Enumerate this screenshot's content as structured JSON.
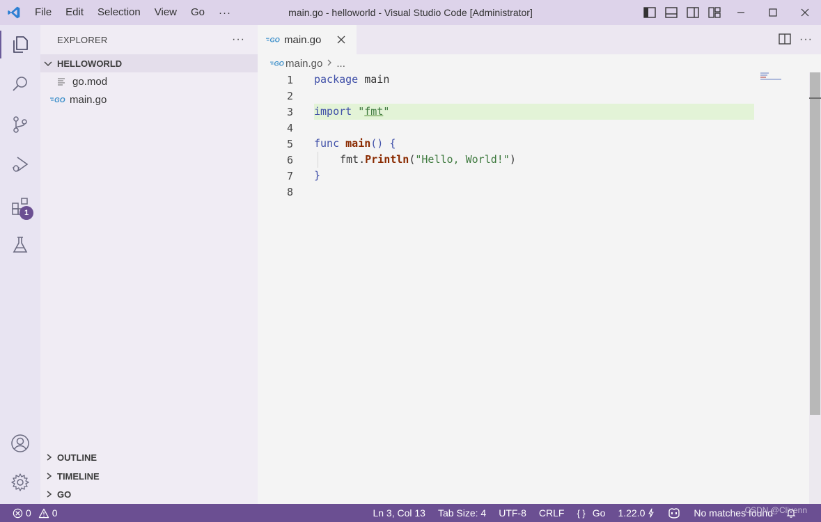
{
  "window": {
    "title": "main.go - helloworld - Visual Studio Code [Administrator]",
    "menu": [
      "File",
      "Edit",
      "Selection",
      "View",
      "Go"
    ],
    "menu_more": "···"
  },
  "activity_bar": {
    "items": [
      "explorer",
      "search",
      "source-control",
      "run-and-debug",
      "extensions",
      "testing"
    ],
    "extensions_badge": "1",
    "bottom": [
      "accounts",
      "manage"
    ]
  },
  "sidebar": {
    "title": "EXPLORER",
    "more": "···",
    "folder": "HELLOWORLD",
    "files": [
      {
        "name": "go.mod",
        "icon": "text-file-icon"
      },
      {
        "name": "main.go",
        "icon": "go-file-icon"
      }
    ],
    "sections": [
      "OUTLINE",
      "TIMELINE",
      "GO"
    ]
  },
  "editor": {
    "tab": {
      "label": "main.go",
      "icon": "go-file-icon"
    },
    "breadcrumb": {
      "file": "main.go",
      "rest": "..."
    },
    "lines": [
      {
        "n": "1"
      },
      {
        "n": "2"
      },
      {
        "n": "3"
      },
      {
        "n": "4"
      },
      {
        "n": "5"
      },
      {
        "n": "6"
      },
      {
        "n": "7"
      },
      {
        "n": "8"
      }
    ],
    "code": {
      "l1_kw": "package",
      "l1_rest": " main",
      "l3_kw": "import",
      "l3_q1": " \"",
      "l3_pkg": "fmt",
      "l3_q2": "\"",
      "l5_kw": "func",
      "l5_sp": " ",
      "l5_fn": "main",
      "l5_rest": "() {",
      "l6_pkg": "fmt",
      "l6_dot": ".",
      "l6_fn": "Println",
      "l6_open": "(",
      "l6_str": "\"Hello, World!\"",
      "l6_close": ")",
      "l7": "}"
    },
    "highlight_color": "#e3f3d7"
  },
  "status": {
    "errors": "0",
    "warnings": "0",
    "position": "Ln 3, Col 13",
    "tab_size": "Tab Size: 4",
    "encoding": "UTF-8",
    "eol": "CRLF",
    "language_icon": "{ }",
    "language": "Go",
    "go_version": "1.22.0",
    "copilot_icon": "copilot-icon",
    "search_status": "No matches found",
    "accent": "#6b4f92"
  },
  "watermark": "CSDN @Clivenn"
}
